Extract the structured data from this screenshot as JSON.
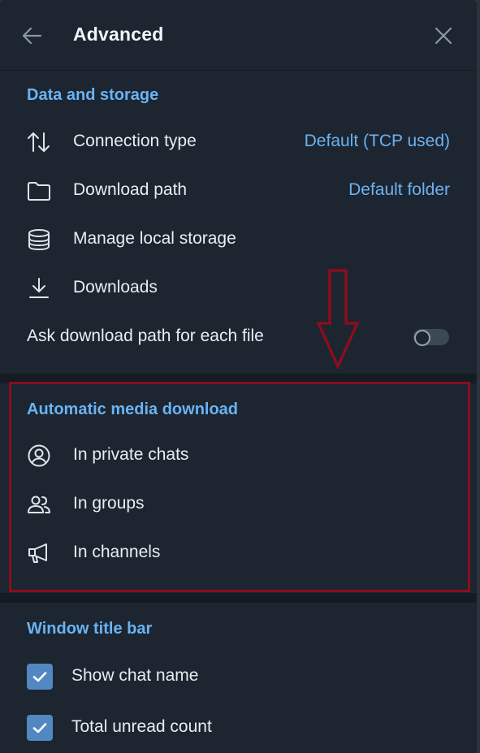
{
  "header": {
    "title": "Advanced",
    "back_icon": "arrow-left-icon",
    "close_icon": "close-icon"
  },
  "data_storage": {
    "title": "Data and storage",
    "connection_type": {
      "label": "Connection type",
      "value": "Default (TCP used)",
      "icon": "arrows-up-down-icon"
    },
    "download_path": {
      "label": "Download path",
      "value": "Default folder",
      "icon": "folder-icon"
    },
    "manage_storage": {
      "label": "Manage local storage",
      "icon": "database-icon"
    },
    "downloads": {
      "label": "Downloads",
      "icon": "download-icon"
    },
    "ask_path": {
      "label": "Ask download path for each file",
      "enabled": false
    }
  },
  "auto_media": {
    "title": "Automatic media download",
    "private_chats": {
      "label": "In private chats",
      "icon": "user-circle-icon"
    },
    "groups": {
      "label": "In groups",
      "icon": "users-icon"
    },
    "channels": {
      "label": "In channels",
      "icon": "megaphone-icon"
    }
  },
  "window_title": {
    "title": "Window title bar",
    "show_chat_name": {
      "label": "Show chat name",
      "checked": true
    },
    "total_unread": {
      "label": "Total unread count",
      "checked": true
    }
  },
  "colors": {
    "accent": "#6ab3f3",
    "background": "#1c2530",
    "annotation": "#8b0d1f",
    "checkbox": "#5288c1"
  }
}
